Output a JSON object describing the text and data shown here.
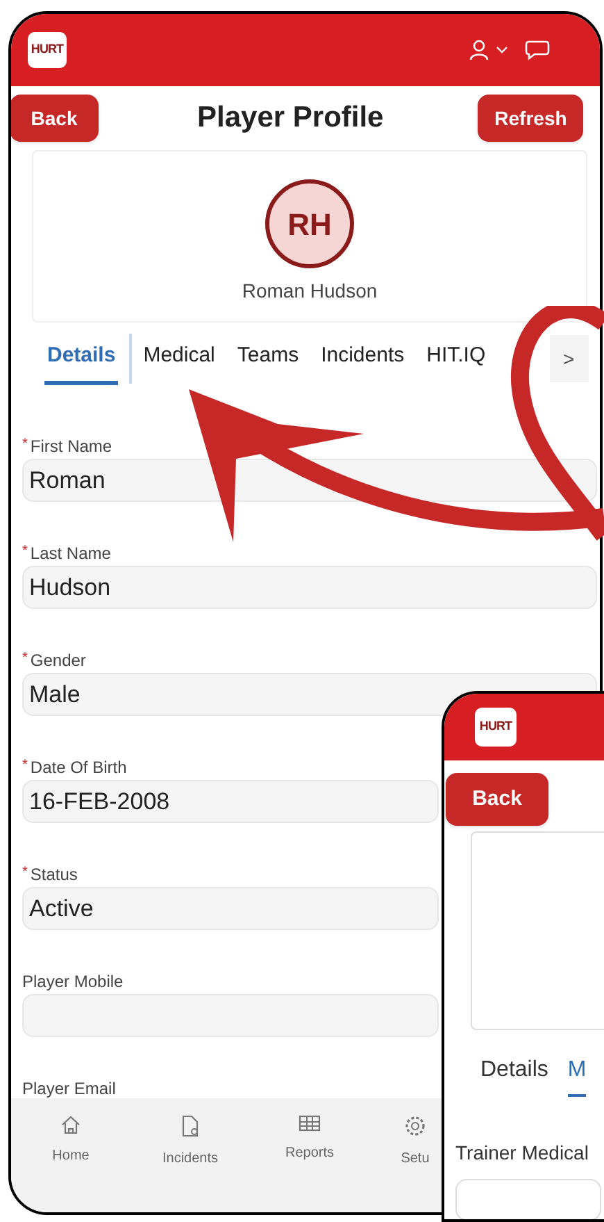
{
  "main_screen": {
    "logo": "HURT",
    "back_button": "Back",
    "title": "Player Profile",
    "refresh_button": "Refresh",
    "profile": {
      "initials": "RH",
      "name": "Roman Hudson"
    },
    "tabs": [
      {
        "label": "Details",
        "selected": true
      },
      {
        "label": "Medical",
        "selected": false
      },
      {
        "label": "Teams",
        "selected": false
      },
      {
        "label": "Incidents",
        "selected": false
      },
      {
        "label": "HIT.IQ",
        "selected": false
      }
    ],
    "tabs_more": ">",
    "fields": [
      {
        "kind": "input",
        "required_mark": "*",
        "label": "First Name",
        "value": "Roman"
      },
      {
        "kind": "input",
        "required_mark": "*",
        "label": "Last Name",
        "value": "Hudson"
      },
      {
        "kind": "input",
        "required_mark": "*",
        "label": "Gender",
        "value": "Male"
      },
      {
        "kind": "input",
        "required_mark": "*",
        "label": "Date Of Birth",
        "value": "16-FEB-2008"
      },
      {
        "kind": "input",
        "required_mark": "*",
        "label": "Status",
        "value": "Active"
      },
      {
        "kind": "input",
        "label": "Player Mobile"
      },
      {
        "kind": "label",
        "label": "Player Email"
      }
    ],
    "bottom_nav": [
      {
        "kind": "home",
        "label": "Home"
      },
      {
        "kind": "incidents",
        "label": "Incidents"
      },
      {
        "kind": "reports",
        "label": "Reports"
      },
      {
        "kind": "setup",
        "label": "Setu"
      }
    ]
  },
  "second_screen": {
    "logo": "HURT",
    "back_button": "Back",
    "tabs": [
      {
        "label": "Details",
        "selected": false
      },
      {
        "label": "M",
        "selected": true
      }
    ],
    "field_label": "Trainer Medical"
  }
}
